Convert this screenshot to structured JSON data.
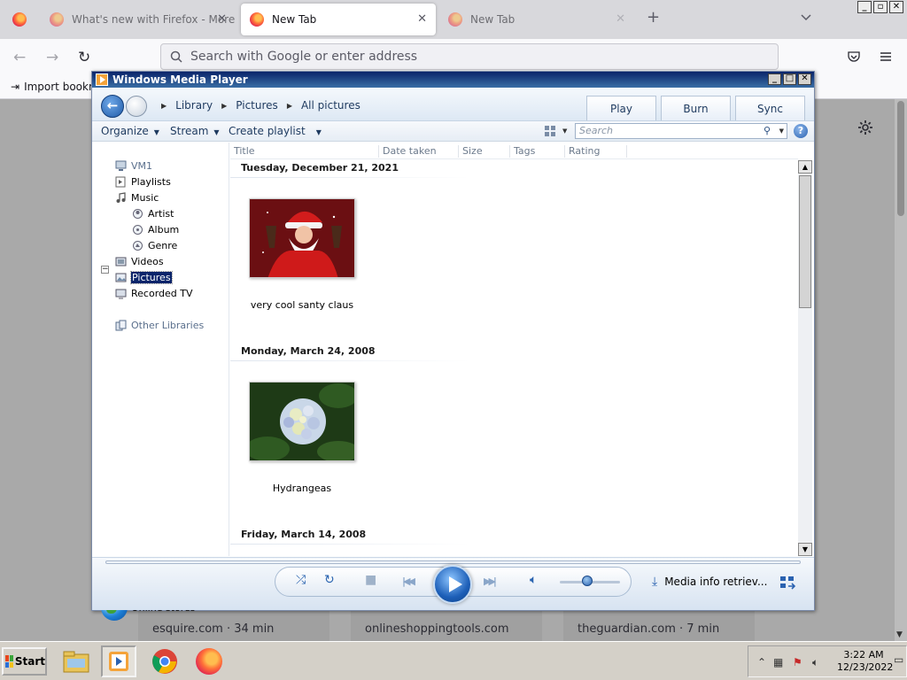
{
  "firefox": {
    "tabs": [
      {
        "label": "What's new with Firefox - More pri"
      },
      {
        "label": "New Tab"
      },
      {
        "label": "New Tab"
      }
    ],
    "urlbar_placeholder": "Search with Google or enter address",
    "import_bookmarks": "Import bookma",
    "top_sites": [
      "esquire.com · 34 min",
      "onlineshoppingtools.com",
      "theguardian.com · 7 min"
    ]
  },
  "wmp": {
    "title": "Windows Media Player",
    "breadcrumb": [
      "Library",
      "Pictures",
      "All pictures"
    ],
    "tabs": {
      "play": "Play",
      "burn": "Burn",
      "sync": "Sync"
    },
    "toolbar": {
      "organize": "Organize",
      "stream": "Stream",
      "create_playlist": "Create playlist"
    },
    "search_placeholder": "Search",
    "help": "?",
    "nav": {
      "vm1": "VM1",
      "playlists": "Playlists",
      "music": "Music",
      "artist": "Artist",
      "album": "Album",
      "genre": "Genre",
      "videos": "Videos",
      "pictures": "Pictures",
      "recorded_tv": "Recorded TV",
      "other_libraries": "Other Libraries",
      "online_stores": "Online stores"
    },
    "columns": [
      "Title",
      "Date taken",
      "Size",
      "Tags",
      "Rating"
    ],
    "groups": [
      {
        "date": "Tuesday, December 21, 2021",
        "items": [
          {
            "title": "very cool santy claus"
          }
        ]
      },
      {
        "date": "Monday, March 24, 2008",
        "items": [
          {
            "title": "Hydrangeas"
          }
        ]
      },
      {
        "date": "Friday, March 14, 2008",
        "items": []
      }
    ],
    "status": "Media info retriev...",
    "volume_level": 0.45
  },
  "taskbar": {
    "start": "Start",
    "time": "3:22 AM",
    "date": "12/23/2022"
  },
  "colors": {
    "wmp_title_bar": "#0a246a",
    "wmp_accent": "#1d5fb8",
    "taskbar": "#d4d0c8"
  }
}
